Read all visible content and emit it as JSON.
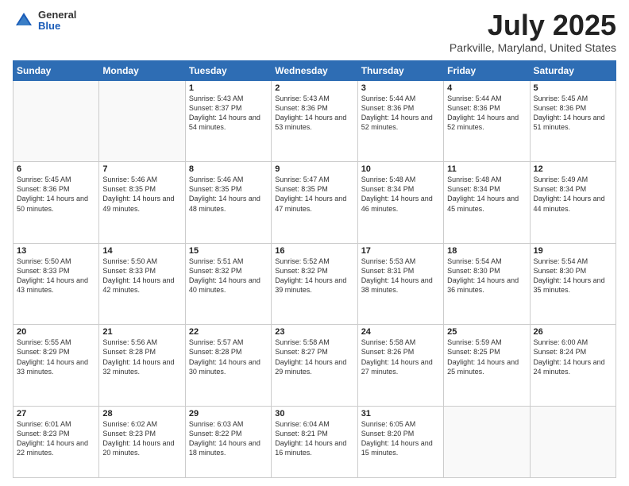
{
  "header": {
    "logo": {
      "line1": "General",
      "line2": "Blue"
    },
    "title": "July 2025",
    "subtitle": "Parkville, Maryland, United States"
  },
  "calendar": {
    "headers": [
      "Sunday",
      "Monday",
      "Tuesday",
      "Wednesday",
      "Thursday",
      "Friday",
      "Saturday"
    ],
    "weeks": [
      [
        {
          "day": "",
          "info": ""
        },
        {
          "day": "",
          "info": ""
        },
        {
          "day": "1",
          "info": "Sunrise: 5:43 AM\nSunset: 8:37 PM\nDaylight: 14 hours and 54 minutes."
        },
        {
          "day": "2",
          "info": "Sunrise: 5:43 AM\nSunset: 8:36 PM\nDaylight: 14 hours and 53 minutes."
        },
        {
          "day": "3",
          "info": "Sunrise: 5:44 AM\nSunset: 8:36 PM\nDaylight: 14 hours and 52 minutes."
        },
        {
          "day": "4",
          "info": "Sunrise: 5:44 AM\nSunset: 8:36 PM\nDaylight: 14 hours and 52 minutes."
        },
        {
          "day": "5",
          "info": "Sunrise: 5:45 AM\nSunset: 8:36 PM\nDaylight: 14 hours and 51 minutes."
        }
      ],
      [
        {
          "day": "6",
          "info": "Sunrise: 5:45 AM\nSunset: 8:36 PM\nDaylight: 14 hours and 50 minutes."
        },
        {
          "day": "7",
          "info": "Sunrise: 5:46 AM\nSunset: 8:35 PM\nDaylight: 14 hours and 49 minutes."
        },
        {
          "day": "8",
          "info": "Sunrise: 5:46 AM\nSunset: 8:35 PM\nDaylight: 14 hours and 48 minutes."
        },
        {
          "day": "9",
          "info": "Sunrise: 5:47 AM\nSunset: 8:35 PM\nDaylight: 14 hours and 47 minutes."
        },
        {
          "day": "10",
          "info": "Sunrise: 5:48 AM\nSunset: 8:34 PM\nDaylight: 14 hours and 46 minutes."
        },
        {
          "day": "11",
          "info": "Sunrise: 5:48 AM\nSunset: 8:34 PM\nDaylight: 14 hours and 45 minutes."
        },
        {
          "day": "12",
          "info": "Sunrise: 5:49 AM\nSunset: 8:34 PM\nDaylight: 14 hours and 44 minutes."
        }
      ],
      [
        {
          "day": "13",
          "info": "Sunrise: 5:50 AM\nSunset: 8:33 PM\nDaylight: 14 hours and 43 minutes."
        },
        {
          "day": "14",
          "info": "Sunrise: 5:50 AM\nSunset: 8:33 PM\nDaylight: 14 hours and 42 minutes."
        },
        {
          "day": "15",
          "info": "Sunrise: 5:51 AM\nSunset: 8:32 PM\nDaylight: 14 hours and 40 minutes."
        },
        {
          "day": "16",
          "info": "Sunrise: 5:52 AM\nSunset: 8:32 PM\nDaylight: 14 hours and 39 minutes."
        },
        {
          "day": "17",
          "info": "Sunrise: 5:53 AM\nSunset: 8:31 PM\nDaylight: 14 hours and 38 minutes."
        },
        {
          "day": "18",
          "info": "Sunrise: 5:54 AM\nSunset: 8:30 PM\nDaylight: 14 hours and 36 minutes."
        },
        {
          "day": "19",
          "info": "Sunrise: 5:54 AM\nSunset: 8:30 PM\nDaylight: 14 hours and 35 minutes."
        }
      ],
      [
        {
          "day": "20",
          "info": "Sunrise: 5:55 AM\nSunset: 8:29 PM\nDaylight: 14 hours and 33 minutes."
        },
        {
          "day": "21",
          "info": "Sunrise: 5:56 AM\nSunset: 8:28 PM\nDaylight: 14 hours and 32 minutes."
        },
        {
          "day": "22",
          "info": "Sunrise: 5:57 AM\nSunset: 8:28 PM\nDaylight: 14 hours and 30 minutes."
        },
        {
          "day": "23",
          "info": "Sunrise: 5:58 AM\nSunset: 8:27 PM\nDaylight: 14 hours and 29 minutes."
        },
        {
          "day": "24",
          "info": "Sunrise: 5:58 AM\nSunset: 8:26 PM\nDaylight: 14 hours and 27 minutes."
        },
        {
          "day": "25",
          "info": "Sunrise: 5:59 AM\nSunset: 8:25 PM\nDaylight: 14 hours and 25 minutes."
        },
        {
          "day": "26",
          "info": "Sunrise: 6:00 AM\nSunset: 8:24 PM\nDaylight: 14 hours and 24 minutes."
        }
      ],
      [
        {
          "day": "27",
          "info": "Sunrise: 6:01 AM\nSunset: 8:23 PM\nDaylight: 14 hours and 22 minutes."
        },
        {
          "day": "28",
          "info": "Sunrise: 6:02 AM\nSunset: 8:23 PM\nDaylight: 14 hours and 20 minutes."
        },
        {
          "day": "29",
          "info": "Sunrise: 6:03 AM\nSunset: 8:22 PM\nDaylight: 14 hours and 18 minutes."
        },
        {
          "day": "30",
          "info": "Sunrise: 6:04 AM\nSunset: 8:21 PM\nDaylight: 14 hours and 16 minutes."
        },
        {
          "day": "31",
          "info": "Sunrise: 6:05 AM\nSunset: 8:20 PM\nDaylight: 14 hours and 15 minutes."
        },
        {
          "day": "",
          "info": ""
        },
        {
          "day": "",
          "info": ""
        }
      ]
    ]
  }
}
